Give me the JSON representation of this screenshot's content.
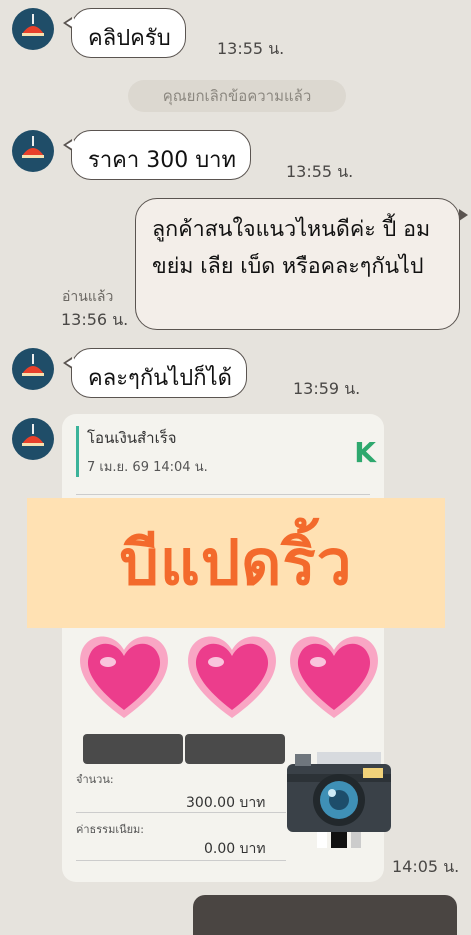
{
  "messages": [
    {
      "text": "คลิปครับ",
      "time": "13:55 น."
    },
    {
      "system": "คุณยกเลิกข้อความแล้ว"
    },
    {
      "text": "ราคา 300 บาท",
      "time": "13:55 น."
    },
    {
      "text": "ลูกค้าสนใจแนวไหนดีค่ะ ปี้ อม ขย่ม เลีย เบ็ด หรือคละๆกันไป",
      "read": "อ่านแล้ว",
      "time": "13:56 น."
    },
    {
      "text": "คละๆกันไปก็ได้",
      "time": "13:59 น."
    }
  ],
  "slip": {
    "title": "โอนเงินสำเร็จ",
    "date": "7 เม.ย. 69  14:04 น.",
    "logo": "K",
    "promo": "บีแปดริ้ว",
    "amount_label": "จำนวน:",
    "amount": "300.00 บาท",
    "fee_label": "ค่าธรรมเนียม:",
    "fee": "0.00 บาท",
    "time": "14:05 น."
  },
  "colors": {
    "background": "#e6e3dd",
    "avatar": "#1f4d68",
    "promo_text": "#f36a2c",
    "promo_bg": "#ffe1b3",
    "accent": "#3bb39a"
  },
  "icons": {
    "avatar": "red-lamp-icon",
    "hearts": "heart-icon",
    "camera": "camera-icon"
  }
}
